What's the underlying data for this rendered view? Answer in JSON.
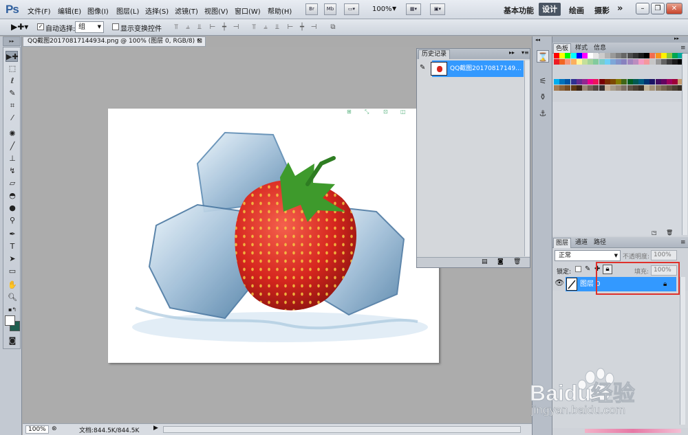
{
  "app": {
    "logo": "Ps",
    "menus": [
      "文件(F)",
      "编辑(E)",
      "图像(I)",
      "图层(L)",
      "选择(S)",
      "滤镜(T)",
      "视图(V)",
      "窗口(W)",
      "帮助(H)"
    ],
    "bridge_btn": "Br",
    "minibridge_btn": "Mb",
    "zoom_menu": "100%",
    "workspaces": [
      "基本功能",
      "设计",
      "绘画",
      "摄影"
    ],
    "active_workspace": "设计",
    "more": "»"
  },
  "options": {
    "auto_select_label": "自动选择:",
    "auto_select_value": "组",
    "show_transform_label": "显示变换控件"
  },
  "document": {
    "tab_title": "QQ截图20170817144934.png @ 100% (图层 0, RGB/8) *",
    "zoom": "100%",
    "doc_size": "文档:844.5K/844.5K"
  },
  "history": {
    "tab": "历史记录",
    "snapshot_label": "QQ截图20170817149..."
  },
  "swatches": {
    "tabs": [
      "色板",
      "样式",
      "信息"
    ]
  },
  "layers": {
    "tabs": [
      "图层",
      "通道",
      "路径"
    ],
    "blend_mode": "正常",
    "opacity_label": "不透明度:",
    "opacity_value": "100%",
    "lock_label": "锁定:",
    "fill_label": "填充:",
    "fill_value": "100%",
    "layer_name": "图层 0"
  },
  "watermark": {
    "brand": "Baidu经验",
    "url": "jingyan.baidu.com"
  },
  "colors": {
    "selection_blue": "#3399ff",
    "highlight_red": "#e0302a",
    "foreground": "#ffffff",
    "background": "#1f5e4f"
  }
}
